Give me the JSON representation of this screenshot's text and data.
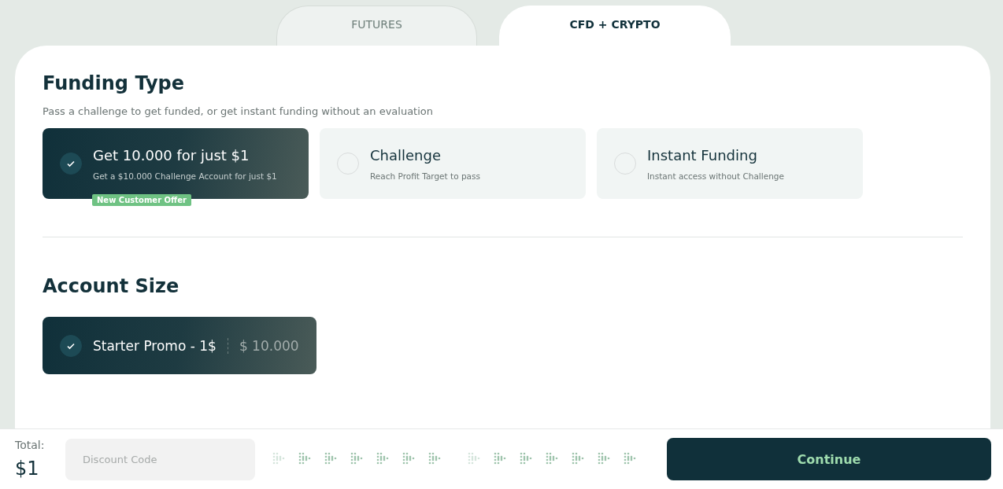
{
  "tabs": [
    {
      "label": "FUTURES",
      "selected": false
    },
    {
      "label": "CFD + CRYPTO",
      "selected": true
    }
  ],
  "funding": {
    "title": "Funding Type",
    "subtitle": "Pass a challenge to get funded, or get instant funding without an evaluation",
    "options": [
      {
        "title": "Get 10.000 for just $1",
        "description": "Get a $10.000 Challenge Account for just $1",
        "badge": "New Customer Offer",
        "selected": true
      },
      {
        "title": "Challenge",
        "description": "Reach Profit Target to pass",
        "selected": false
      },
      {
        "title": "Instant Funding",
        "description": "Instant access without Challenge",
        "selected": false
      }
    ]
  },
  "account_size": {
    "title": "Account Size",
    "options": [
      {
        "name": "Starter Promo - 1$",
        "amount": "$ 10.000",
        "selected": true
      }
    ]
  },
  "footer": {
    "total_label": "Total:",
    "total": "$1",
    "discount": {
      "placeholder": "Discount Code"
    },
    "continue": "Continue"
  }
}
